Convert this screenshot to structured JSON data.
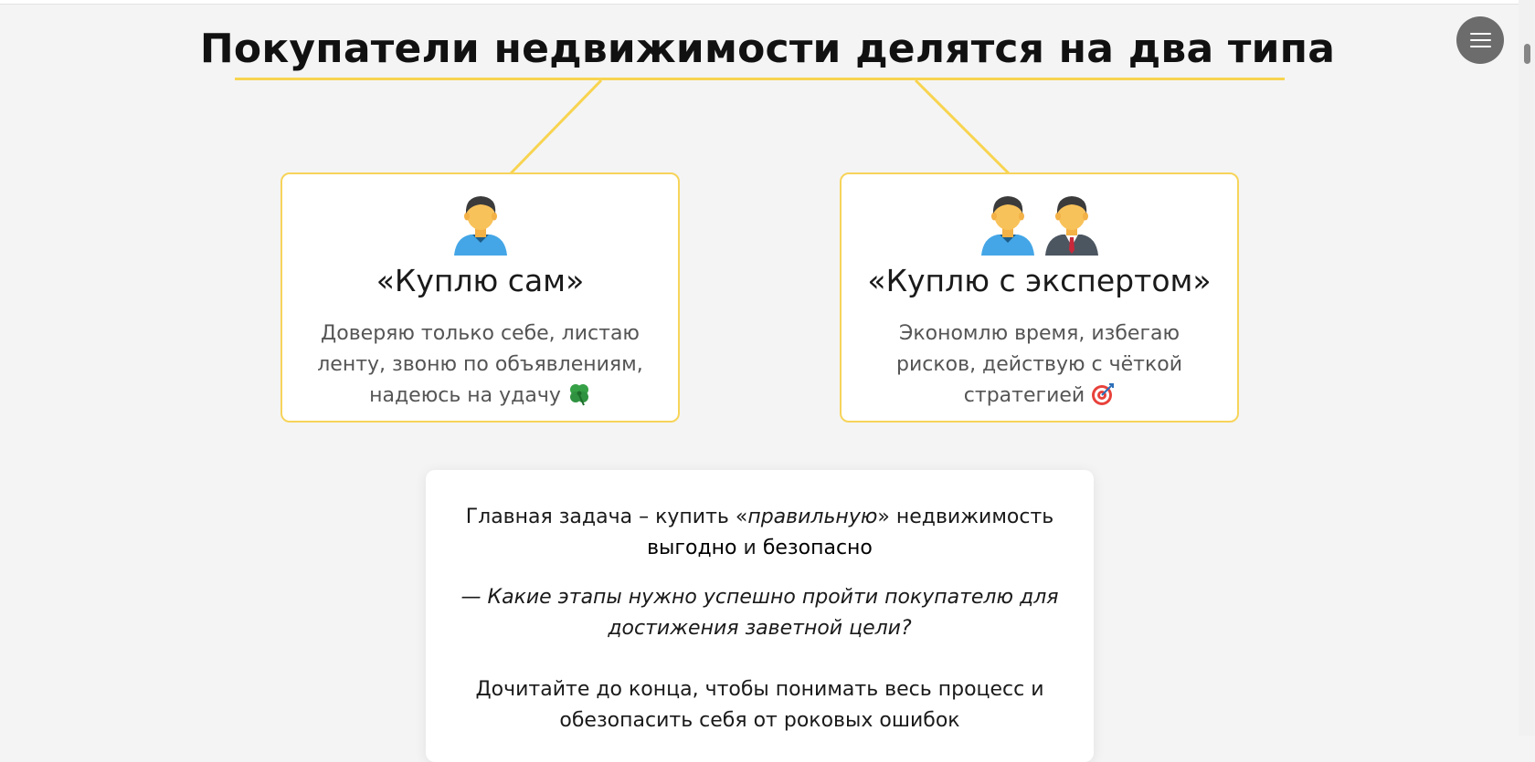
{
  "heading": "Покупатели недвижимости делятся на два типа",
  "colors": {
    "accent": "#f8d450",
    "card_border": "#f7d45a",
    "menu_button": "#6c6c6c"
  },
  "cards": [
    {
      "title": "«Куплю сам»",
      "text": "Доверяю только себе, листаю ленту, звоню по объявлениям, надеюсь на удачу",
      "icons": [
        "person-blue-shirt-icon"
      ],
      "emoji": "four-leaf-clover-icon"
    },
    {
      "title": "«Куплю с экспертом»",
      "text": "Экономлю время, избегаю рисков, действую с чёткой стратегией",
      "icons": [
        "person-blue-shirt-icon",
        "person-suit-icon"
      ],
      "emoji": "target-icon"
    }
  ],
  "info": {
    "line1_start": "Главная задача – купить «",
    "line1_italic": "правильную",
    "line1_end": "» недвижимость",
    "line2_bold1": "выгодно",
    "line2_mid": " и ",
    "line2_bold2": "безопасно",
    "question": "— Какие этапы нужно успешно пройти покупателю для достижения заветной цели?",
    "cta": "Дочитайте до конца, чтобы понимать весь процесс и обезопасить себя от роковых ошибок"
  },
  "menu_icon": "hamburger-menu-icon"
}
